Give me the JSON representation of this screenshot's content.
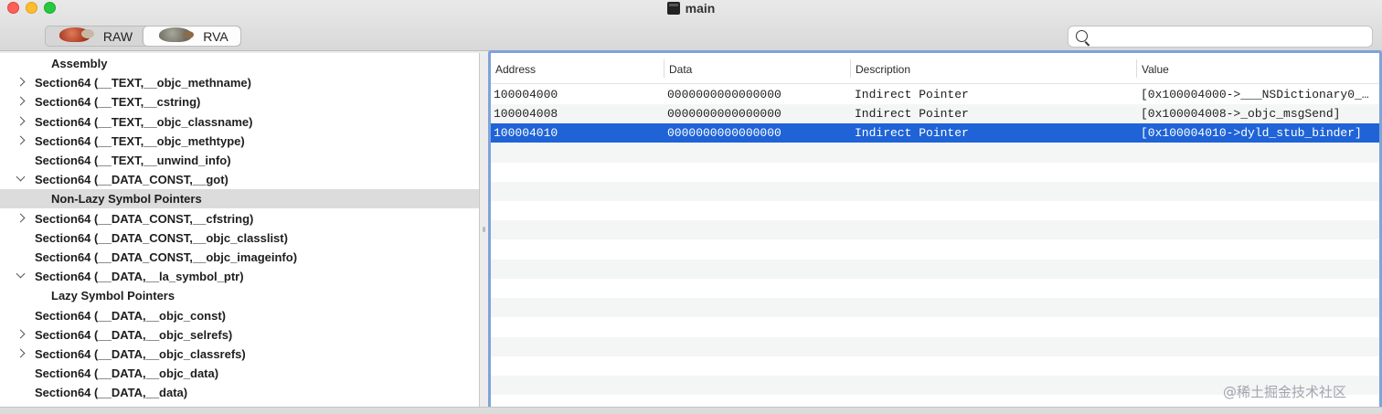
{
  "window": {
    "title": "main"
  },
  "toolbar": {
    "segments": [
      {
        "label": "RAW",
        "icon": "raw-animal-icon",
        "selected": false
      },
      {
        "label": "RVA",
        "icon": "rva-animal-icon",
        "selected": true
      }
    ],
    "search": {
      "value": "",
      "placeholder": ""
    }
  },
  "sidebar": {
    "items": [
      {
        "label": "Assembly",
        "level": 1,
        "disclosure": "none",
        "selected": false
      },
      {
        "label": "Section64 (__TEXT,__objc_methname)",
        "level": 0,
        "disclosure": "collapsed",
        "selected": false
      },
      {
        "label": "Section64 (__TEXT,__cstring)",
        "level": 0,
        "disclosure": "collapsed",
        "selected": false
      },
      {
        "label": "Section64 (__TEXT,__objc_classname)",
        "level": 0,
        "disclosure": "collapsed",
        "selected": false
      },
      {
        "label": "Section64 (__TEXT,__objc_methtype)",
        "level": 0,
        "disclosure": "collapsed",
        "selected": false
      },
      {
        "label": "Section64 (__TEXT,__unwind_info)",
        "level": 0,
        "disclosure": "none",
        "selected": false
      },
      {
        "label": "Section64 (__DATA_CONST,__got)",
        "level": 0,
        "disclosure": "expanded",
        "selected": false
      },
      {
        "label": "Non-Lazy Symbol Pointers",
        "level": 1,
        "disclosure": "none",
        "selected": true
      },
      {
        "label": "Section64 (__DATA_CONST,__cfstring)",
        "level": 0,
        "disclosure": "collapsed",
        "selected": false
      },
      {
        "label": "Section64 (__DATA_CONST,__objc_classlist)",
        "level": 0,
        "disclosure": "none",
        "selected": false
      },
      {
        "label": "Section64 (__DATA_CONST,__objc_imageinfo)",
        "level": 0,
        "disclosure": "none",
        "selected": false
      },
      {
        "label": "Section64 (__DATA,__la_symbol_ptr)",
        "level": 0,
        "disclosure": "expanded",
        "selected": false
      },
      {
        "label": "Lazy Symbol Pointers",
        "level": 1,
        "disclosure": "none",
        "selected": false
      },
      {
        "label": "Section64 (__DATA,__objc_const)",
        "level": 0,
        "disclosure": "none",
        "selected": false
      },
      {
        "label": "Section64 (__DATA,__objc_selrefs)",
        "level": 0,
        "disclosure": "collapsed",
        "selected": false
      },
      {
        "label": "Section64 (__DATA,__objc_classrefs)",
        "level": 0,
        "disclosure": "collapsed",
        "selected": false
      },
      {
        "label": "Section64 (__DATA,__objc_data)",
        "level": 0,
        "disclosure": "none",
        "selected": false
      },
      {
        "label": "Section64 (__DATA,__data)",
        "level": 0,
        "disclosure": "none",
        "selected": false
      }
    ]
  },
  "table": {
    "columns": [
      "Address",
      "Data",
      "Description",
      "Value"
    ],
    "rows": [
      {
        "address": "100004000",
        "data": "0000000000000000",
        "description": "Indirect Pointer",
        "value": "[0x100004000->___NSDictionary0_…",
        "selected": false
      },
      {
        "address": "100004008",
        "data": "0000000000000000",
        "description": "Indirect Pointer",
        "value": "[0x100004008->_objc_msgSend]",
        "selected": false
      },
      {
        "address": "100004010",
        "data": "0000000000000000",
        "description": "Indirect Pointer",
        "value": "[0x100004010->dyld_stub_binder]",
        "selected": true
      }
    ],
    "empty_rows": 14
  },
  "watermark": "@稀土掘金技术社区",
  "colors": {
    "selection": "#1f63d6",
    "focus_ring": "#7ea3d9",
    "sidebar_selection": "#dcdcdc"
  }
}
